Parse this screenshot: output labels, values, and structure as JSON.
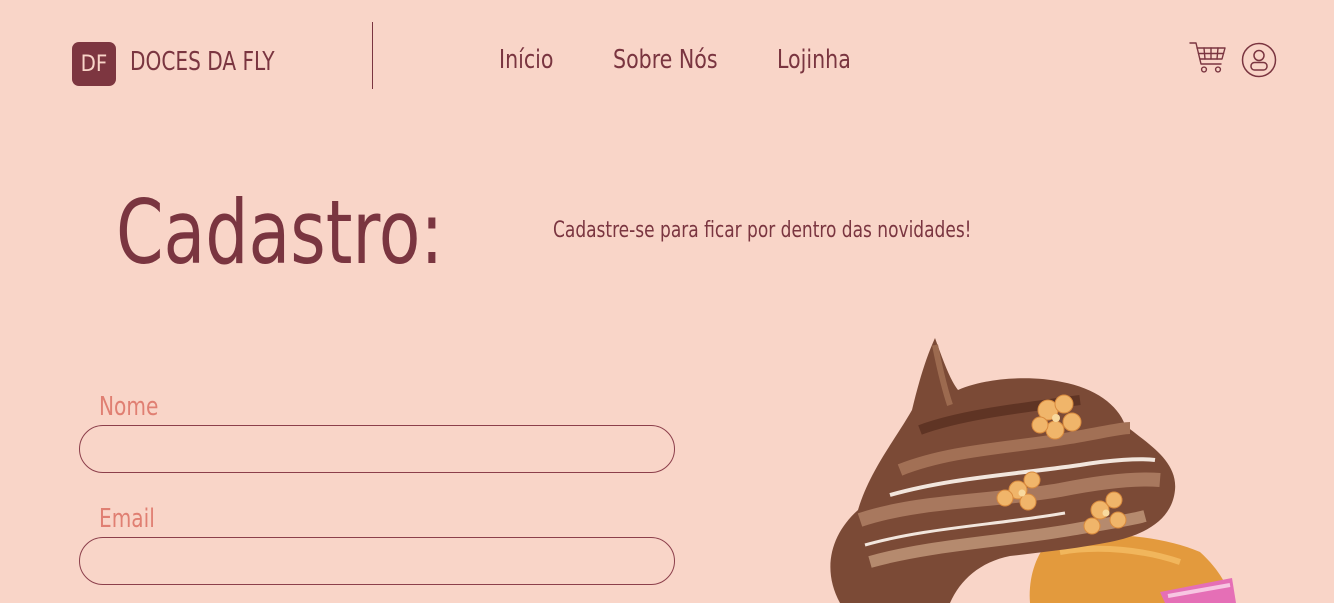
{
  "header": {
    "logo_mark": "DF",
    "brand_name": "DOCES DA FLY",
    "nav": [
      "Início",
      "Sobre Nós",
      "Lojinha"
    ],
    "cart_icon": "shopping-cart-icon",
    "user_icon": "user-circle-icon"
  },
  "main": {
    "title": "Cadastro:",
    "subtitle": "Cadastre-se para ficar por dentro das novidades!",
    "form": {
      "name_label": "Nome",
      "name_value": "",
      "email_label": "Email",
      "email_value": ""
    },
    "illustration": "watercolor-cupcake-illustration"
  },
  "colors": {
    "background": "#f9d5c8",
    "primary": "#7a3540",
    "label": "#e07f72"
  }
}
